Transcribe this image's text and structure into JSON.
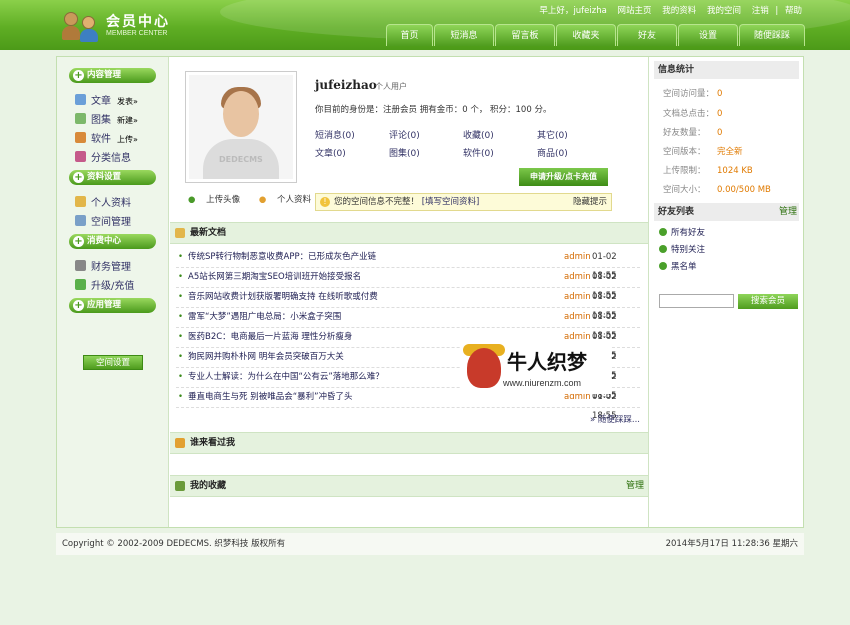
{
  "header": {
    "title": "会员中心",
    "subtitle": "MEMBER CENTER"
  },
  "toplinks": {
    "greeting": "早上好，",
    "user": "jufeizha",
    "items": [
      "网站主页",
      "我的资料",
      "我的空间",
      "注销"
    ],
    "help": "帮助"
  },
  "nav": [
    "首页",
    "短消息",
    "留言板",
    "收藏夹",
    "好友",
    "设置",
    "随便踩踩"
  ],
  "sidebar": {
    "sections": [
      "内容管理",
      "资料设置",
      "消费中心",
      "应用管理"
    ],
    "content_items": [
      {
        "label": "文章",
        "extra": "发表»"
      },
      {
        "label": "图集",
        "extra": "新建»"
      },
      {
        "label": "软件",
        "extra": "上传»"
      },
      {
        "label": "分类信息",
        "extra": ""
      }
    ],
    "profile_items": [
      "个人资料",
      "空间管理"
    ],
    "pay_items": [
      "财务管理",
      "升级/充值"
    ],
    "space_button": "空间设置"
  },
  "profile": {
    "avatar_watermark": "DEDECMS",
    "upload_avatar": "上传头像",
    "personal_info": "个人资料",
    "username": "jufeizhao",
    "user_type": "个人用户",
    "identity": "你目前的身份是：注册会员 拥有金币：0 个， 积分：100 分。",
    "stats": [
      "短消息(0)",
      "评论(0)",
      "收藏(0)",
      "其它(0)",
      "文章(0)",
      "图集(0)",
      "软件(0)",
      "商品(0)"
    ],
    "upgrade_button": "申请升级/点卡充值",
    "warning": "您的空间信息不完整！",
    "warning_link": "[填写空间资料]",
    "hide_tip": "隐藏提示"
  },
  "latest": {
    "title": "最新文档",
    "rows": [
      {
        "title": "传统SP转行物制恶意收费APP：已形成灰色产业链",
        "author": "admin",
        "date": "01-02 18:55"
      },
      {
        "title": "A5站长网第三期淘宝SEO培训班开始接受报名",
        "author": "admin",
        "date": "01-02 18:55"
      },
      {
        "title": "音乐网站收费计划获版署明确支持 在线听歌或付费",
        "author": "admin",
        "date": "01-02 18:55"
      },
      {
        "title": "雷军“大梦”遇阻广电总局：小米盒子突围",
        "author": "admin",
        "date": "01-02 18:55"
      },
      {
        "title": "医药B2C：电商最后一片蓝海 理性分析瘦身",
        "author": "admin",
        "date": "01-02 18:55"
      },
      {
        "title": "狗民网并购朴朴网 明年会员突破百万大关",
        "author": "admin",
        "date": "01-02 18:55"
      },
      {
        "title": "专业人士解读：为什么在中国“公有云”落地那么难？",
        "author": "admin",
        "date": "01-02 18:55"
      },
      {
        "title": "垂直电商生与死 别被唯品会“暴利”冲昏了头",
        "author": "admin",
        "date": "01-02 18:55"
      }
    ],
    "more": "» 随便踩踩..."
  },
  "visitors": {
    "title": "谁来看过我"
  },
  "favorites": {
    "title": "我的收藏",
    "manage": "管理"
  },
  "watermark": {
    "title": "牛人织梦",
    "url": "www.niurenzm.com"
  },
  "info_stats": {
    "title": "信息统计",
    "rows": [
      {
        "label": "空间访问量：",
        "value": "0"
      },
      {
        "label": "文档总点击：",
        "value": "0"
      },
      {
        "label": "好友数量：",
        "value": "0"
      },
      {
        "label": "空间版本：",
        "value": "完全新"
      },
      {
        "label": "上传限制：",
        "value": "1024 KB"
      },
      {
        "label": "空间大小：",
        "value": "0.00/500 MB"
      }
    ]
  },
  "friends": {
    "title": "好友列表",
    "manage": "管理",
    "items": [
      "所有好友",
      "特别关注",
      "黑名单"
    ]
  },
  "search": {
    "button": "搜索会员",
    "value": ""
  },
  "footer": {
    "copyright": "Copyright © 2002-2009 DEDECMS. 织梦科技 版权所有",
    "datetime": "2014年5月17日 11:28:36 星期六"
  }
}
